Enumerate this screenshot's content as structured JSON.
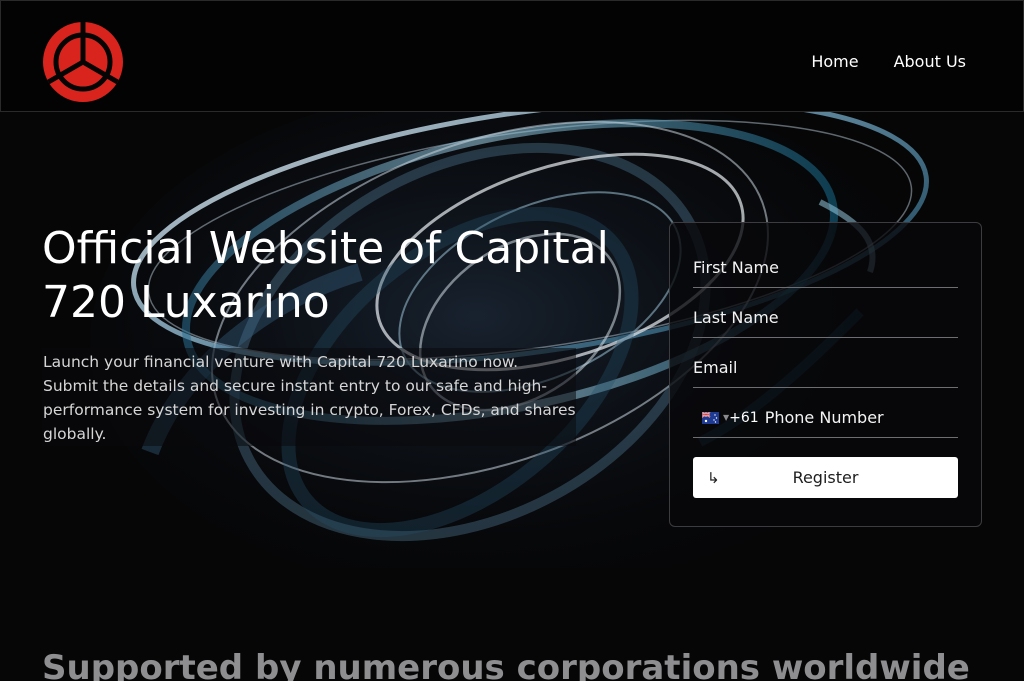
{
  "colors": {
    "logo_red": "#d8241d",
    "page_background": "#060607",
    "header_background": "#030303",
    "button_background": "#ffffff",
    "heading_gray": "#8e8e91"
  },
  "header": {
    "logo_icon": "tri-spoke-circle-icon",
    "nav": [
      {
        "label": "Home"
      },
      {
        "label": "About Us"
      }
    ]
  },
  "hero": {
    "title": "Official Website of Capital 720 Luxarino",
    "description": "Launch your financial venture with Capital 720 Luxarino now. Submit the details and secure instant entry to our safe and high-performance system for investing in crypto, Forex, CFDs, and shares globally."
  },
  "form": {
    "first_name_placeholder": "First Name",
    "last_name_placeholder": "Last Name",
    "email_placeholder": "Email",
    "phone_flag_icon": "australia-flag-icon",
    "phone_dial_code": "+61",
    "phone_placeholder": "Phone Number",
    "register_icon": "arrow-turn-down-right-icon",
    "register_label": "Register"
  },
  "support": {
    "title": "Supported by numerous corporations worldwide"
  }
}
